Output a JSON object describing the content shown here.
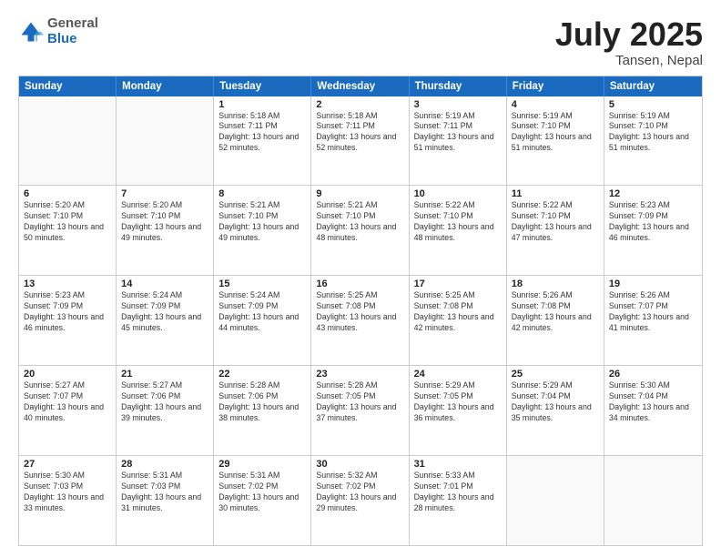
{
  "logo": {
    "general": "General",
    "blue": "Blue"
  },
  "title": "July 2025",
  "location": "Tansen, Nepal",
  "days_of_week": [
    "Sunday",
    "Monday",
    "Tuesday",
    "Wednesday",
    "Thursday",
    "Friday",
    "Saturday"
  ],
  "rows": [
    [
      {
        "day": "",
        "info": "",
        "empty": true
      },
      {
        "day": "",
        "info": "",
        "empty": true
      },
      {
        "day": "1",
        "info": "Sunrise: 5:18 AM\nSunset: 7:11 PM\nDaylight: 13 hours and 52 minutes."
      },
      {
        "day": "2",
        "info": "Sunrise: 5:18 AM\nSunset: 7:11 PM\nDaylight: 13 hours and 52 minutes."
      },
      {
        "day": "3",
        "info": "Sunrise: 5:19 AM\nSunset: 7:11 PM\nDaylight: 13 hours and 51 minutes."
      },
      {
        "day": "4",
        "info": "Sunrise: 5:19 AM\nSunset: 7:10 PM\nDaylight: 13 hours and 51 minutes."
      },
      {
        "day": "5",
        "info": "Sunrise: 5:19 AM\nSunset: 7:10 PM\nDaylight: 13 hours and 51 minutes."
      }
    ],
    [
      {
        "day": "6",
        "info": "Sunrise: 5:20 AM\nSunset: 7:10 PM\nDaylight: 13 hours and 50 minutes."
      },
      {
        "day": "7",
        "info": "Sunrise: 5:20 AM\nSunset: 7:10 PM\nDaylight: 13 hours and 49 minutes."
      },
      {
        "day": "8",
        "info": "Sunrise: 5:21 AM\nSunset: 7:10 PM\nDaylight: 13 hours and 49 minutes."
      },
      {
        "day": "9",
        "info": "Sunrise: 5:21 AM\nSunset: 7:10 PM\nDaylight: 13 hours and 48 minutes."
      },
      {
        "day": "10",
        "info": "Sunrise: 5:22 AM\nSunset: 7:10 PM\nDaylight: 13 hours and 48 minutes."
      },
      {
        "day": "11",
        "info": "Sunrise: 5:22 AM\nSunset: 7:10 PM\nDaylight: 13 hours and 47 minutes."
      },
      {
        "day": "12",
        "info": "Sunrise: 5:23 AM\nSunset: 7:09 PM\nDaylight: 13 hours and 46 minutes."
      }
    ],
    [
      {
        "day": "13",
        "info": "Sunrise: 5:23 AM\nSunset: 7:09 PM\nDaylight: 13 hours and 46 minutes."
      },
      {
        "day": "14",
        "info": "Sunrise: 5:24 AM\nSunset: 7:09 PM\nDaylight: 13 hours and 45 minutes."
      },
      {
        "day": "15",
        "info": "Sunrise: 5:24 AM\nSunset: 7:09 PM\nDaylight: 13 hours and 44 minutes."
      },
      {
        "day": "16",
        "info": "Sunrise: 5:25 AM\nSunset: 7:08 PM\nDaylight: 13 hours and 43 minutes."
      },
      {
        "day": "17",
        "info": "Sunrise: 5:25 AM\nSunset: 7:08 PM\nDaylight: 13 hours and 42 minutes."
      },
      {
        "day": "18",
        "info": "Sunrise: 5:26 AM\nSunset: 7:08 PM\nDaylight: 13 hours and 42 minutes."
      },
      {
        "day": "19",
        "info": "Sunrise: 5:26 AM\nSunset: 7:07 PM\nDaylight: 13 hours and 41 minutes."
      }
    ],
    [
      {
        "day": "20",
        "info": "Sunrise: 5:27 AM\nSunset: 7:07 PM\nDaylight: 13 hours and 40 minutes."
      },
      {
        "day": "21",
        "info": "Sunrise: 5:27 AM\nSunset: 7:06 PM\nDaylight: 13 hours and 39 minutes."
      },
      {
        "day": "22",
        "info": "Sunrise: 5:28 AM\nSunset: 7:06 PM\nDaylight: 13 hours and 38 minutes."
      },
      {
        "day": "23",
        "info": "Sunrise: 5:28 AM\nSunset: 7:05 PM\nDaylight: 13 hours and 37 minutes."
      },
      {
        "day": "24",
        "info": "Sunrise: 5:29 AM\nSunset: 7:05 PM\nDaylight: 13 hours and 36 minutes."
      },
      {
        "day": "25",
        "info": "Sunrise: 5:29 AM\nSunset: 7:04 PM\nDaylight: 13 hours and 35 minutes."
      },
      {
        "day": "26",
        "info": "Sunrise: 5:30 AM\nSunset: 7:04 PM\nDaylight: 13 hours and 34 minutes."
      }
    ],
    [
      {
        "day": "27",
        "info": "Sunrise: 5:30 AM\nSunset: 7:03 PM\nDaylight: 13 hours and 33 minutes."
      },
      {
        "day": "28",
        "info": "Sunrise: 5:31 AM\nSunset: 7:03 PM\nDaylight: 13 hours and 31 minutes."
      },
      {
        "day": "29",
        "info": "Sunrise: 5:31 AM\nSunset: 7:02 PM\nDaylight: 13 hours and 30 minutes."
      },
      {
        "day": "30",
        "info": "Sunrise: 5:32 AM\nSunset: 7:02 PM\nDaylight: 13 hours and 29 minutes."
      },
      {
        "day": "31",
        "info": "Sunrise: 5:33 AM\nSunset: 7:01 PM\nDaylight: 13 hours and 28 minutes."
      },
      {
        "day": "",
        "info": "",
        "empty": true
      },
      {
        "day": "",
        "info": "",
        "empty": true
      }
    ]
  ]
}
